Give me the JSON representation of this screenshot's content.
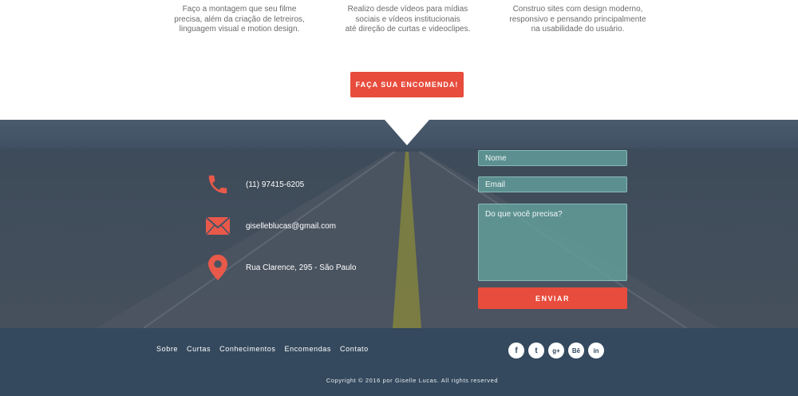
{
  "services": [
    {
      "lines": [
        "Faço a montagem que seu filme",
        "precisa, além da criação de letreiros,",
        "linguagem visual e motion design."
      ]
    },
    {
      "lines": [
        "Realizo desde vídeos para mídias",
        "sociais e vídeos institucionais",
        "até direção de curtas e videoclipes."
      ]
    },
    {
      "lines": [
        "Construo sites com design moderno,",
        "responsivo e pensando principalmente",
        "na usabilidade do usuário."
      ]
    }
  ],
  "cta": {
    "label": "FAÇA SUA ENCOMENDA!"
  },
  "contact": {
    "phone": "(11) 97415-6205",
    "email": "giselleblucas@gmail.com",
    "address": "Rua Clarence, 295 - São Paulo"
  },
  "form": {
    "name_placeholder": "Nome",
    "email_placeholder": "Email",
    "message_placeholder": "Do que você precisa?",
    "submit_label": "ENVIAR"
  },
  "footer": {
    "nav": [
      "Sobre",
      "Curtas",
      "Conhecimentos",
      "Encomendas",
      "Contato"
    ],
    "social": [
      {
        "name": "facebook-icon",
        "glyph": "f"
      },
      {
        "name": "twitter-icon",
        "glyph": "t"
      },
      {
        "name": "google-plus-icon",
        "glyph": "g+"
      },
      {
        "name": "behance-icon",
        "glyph": "Bē"
      },
      {
        "name": "linkedin-icon",
        "glyph": "in"
      }
    ],
    "copyright": "Copyright © 2016 por Giselle Lucas. All rights reserved"
  },
  "colors": {
    "accent": "#e74c3c",
    "footer_bg": "#34495e",
    "input_bg": "#63a09c"
  }
}
